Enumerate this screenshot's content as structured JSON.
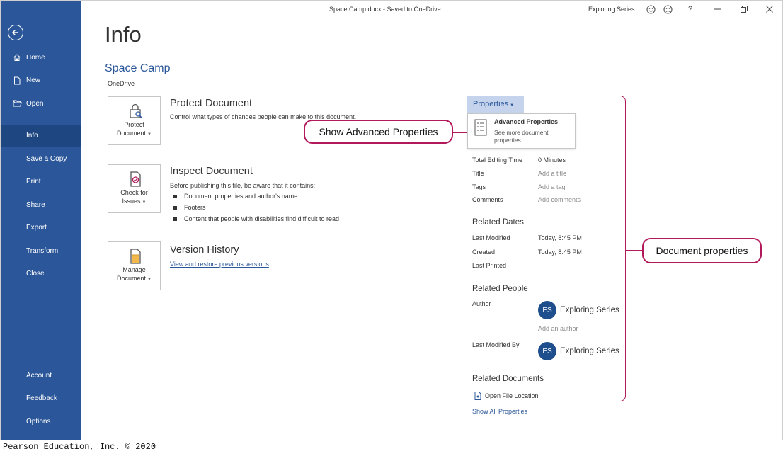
{
  "titlebar": {
    "document_title": "Space Camp.docx  -  Saved to OneDrive",
    "account": "Exploring Series"
  },
  "sidebar": {
    "items": [
      {
        "label": "Home",
        "icon": "home-icon"
      },
      {
        "label": "New",
        "icon": "new-document-icon"
      },
      {
        "label": "Open",
        "icon": "folder-open-icon"
      },
      {
        "label": "Info"
      },
      {
        "label": "Save a Copy"
      },
      {
        "label": "Print"
      },
      {
        "label": "Share"
      },
      {
        "label": "Export"
      },
      {
        "label": "Transform"
      },
      {
        "label": "Close"
      }
    ],
    "bottom_items": [
      {
        "label": "Account"
      },
      {
        "label": "Feedback"
      },
      {
        "label": "Options"
      }
    ],
    "active": "Info",
    "color": "#2b579a"
  },
  "main": {
    "page_title": "Info",
    "document_name": "Space Camp",
    "location": "OneDrive",
    "protect": {
      "button_line1": "Protect",
      "button_line2": "Document",
      "title": "Protect Document",
      "description": "Control what types of changes people can make to this document."
    },
    "inspect": {
      "button_line1": "Check for",
      "button_line2": "Issues",
      "title": "Inspect Document",
      "description": "Before publishing this file, be aware that it contains:",
      "bullets": [
        "Document properties and author's name",
        "Footers",
        "Content that people with disabilities find difficult to read"
      ]
    },
    "version": {
      "button_line1": "Manage",
      "button_line2": "Document",
      "title": "Version History",
      "link": "View and restore previous versions"
    }
  },
  "properties": {
    "button_label": "Properties",
    "menu": {
      "title": "Advanced Properties",
      "description": "See more document properties"
    },
    "fields": [
      {
        "label": "Total Editing Time",
        "value": "0 Minutes",
        "muted": false
      },
      {
        "label": "Title",
        "value": "Add a title",
        "muted": true
      },
      {
        "label": "Tags",
        "value": "Add a tag",
        "muted": true
      },
      {
        "label": "Comments",
        "value": "Add comments",
        "muted": true
      }
    ],
    "related_dates": {
      "header": "Related Dates",
      "last_modified_label": "Last Modified",
      "last_modified_value": "Today, 8:45 PM",
      "created_label": "Created",
      "created_value": "Today, 8:45 PM",
      "last_printed_label": "Last Printed"
    },
    "related_people": {
      "header": "Related People",
      "author_label": "Author",
      "author_initials": "ES",
      "author_name": "Exploring Series",
      "add_author": "Add an author",
      "last_modified_by_label": "Last Modified By",
      "modifier_initials": "ES",
      "modifier_name": "Exploring Series"
    },
    "related_documents": {
      "header": "Related Documents",
      "open_location": "Open File Location"
    },
    "show_all": "Show All Properties"
  },
  "callouts": {
    "advanced": "Show Advanced Properties",
    "document_properties": "Document properties",
    "color": "#b2195a"
  },
  "footer": "Pearson Education, Inc. © 2020"
}
